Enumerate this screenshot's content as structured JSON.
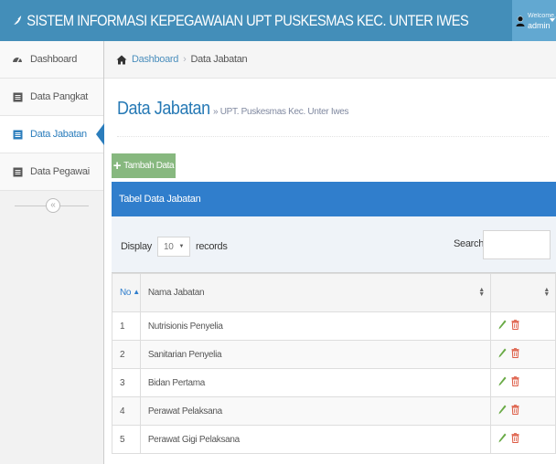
{
  "navbar": {
    "brand": "SISTEM INFORMASI KEPEGAWAIAN UPT PUSKESMAS KEC. UNTER IWES",
    "welcome": "Welcome,",
    "user": "admin"
  },
  "sidebar": {
    "items": [
      {
        "label": "Dashboard",
        "icon": "tachometer-icon"
      },
      {
        "label": "Data Pangkat",
        "icon": "list-icon"
      },
      {
        "label": "Data Jabatan",
        "icon": "list-icon",
        "active": true
      },
      {
        "label": "Data Pegawai",
        "icon": "list-icon"
      }
    ],
    "collapse_glyph": "«"
  },
  "breadcrumb": {
    "home": "Dashboard",
    "current": "Data Jabatan",
    "separator": "›"
  },
  "page": {
    "title": "Data Jabatan",
    "subtitle": "» UPT. Puskesmas Kec. Unter Iwes"
  },
  "toolbar": {
    "add_label": "Tambah Data",
    "add_glyph": "+"
  },
  "table": {
    "heading": "Tabel Data Jabatan",
    "display_prefix": "Display",
    "display_value": "10",
    "display_suffix": "records",
    "search_label": "Search:",
    "search_value": "",
    "columns": [
      "No",
      "Nama Jabatan",
      ""
    ],
    "rows": [
      {
        "no": "1",
        "nama": "Nutrisionis Penyelia"
      },
      {
        "no": "2",
        "nama": "Sanitarian Penyelia"
      },
      {
        "no": "3",
        "nama": "Bidan Pertama"
      },
      {
        "no": "4",
        "nama": "Perawat Pelaksana"
      },
      {
        "no": "5",
        "nama": "Perawat Gigi Pelaksana"
      }
    ]
  },
  "colors": {
    "navbar": "#438eb9",
    "panel_head": "#307ecc",
    "add_button": "#87b87f",
    "edit_icon": "#69aa46",
    "delete_icon": "#dd5a43"
  }
}
